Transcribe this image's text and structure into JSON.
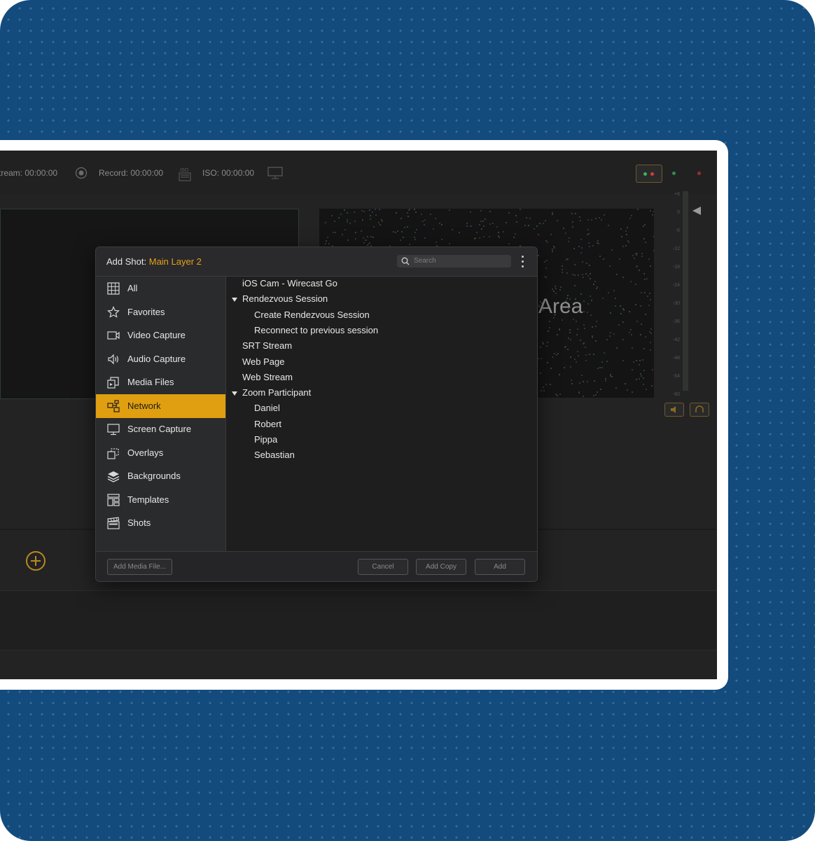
{
  "toolbar": {
    "stream_label": "tream: 00:00:00",
    "record_label": "Record: 00:00:00",
    "iso_label": "ISO: 00:00:00"
  },
  "preview": {
    "area_text": "Area"
  },
  "meter": {
    "labels": [
      "+6",
      "0",
      "-6",
      "-12",
      "-18",
      "-24",
      "-30",
      "-36",
      "-42",
      "-48",
      "-54",
      "-60"
    ]
  },
  "dialog": {
    "title_prefix": "Add Shot:",
    "layer_name": "Main Layer 2",
    "search_placeholder": "Search",
    "sidebar": [
      {
        "label": "All",
        "icon": "grid-icon"
      },
      {
        "label": "Favorites",
        "icon": "star-icon"
      },
      {
        "label": "Video Capture",
        "icon": "video-camera-icon"
      },
      {
        "label": "Audio Capture",
        "icon": "speaker-icon"
      },
      {
        "label": "Media Files",
        "icon": "media-files-icon"
      },
      {
        "label": "Network",
        "icon": "network-icon",
        "active": true
      },
      {
        "label": "Screen Capture",
        "icon": "monitor-icon"
      },
      {
        "label": "Overlays",
        "icon": "overlays-icon"
      },
      {
        "label": "Backgrounds",
        "icon": "layers-icon"
      },
      {
        "label": "Templates",
        "icon": "templates-icon"
      },
      {
        "label": "Shots",
        "icon": "clapperboard-icon"
      }
    ],
    "list": [
      {
        "label": "iOS Cam - Wirecast Go",
        "indent": 0
      },
      {
        "label": "Rendezvous Session",
        "indent": 0,
        "expanded": true
      },
      {
        "label": "Create Rendezvous Session",
        "indent": 1
      },
      {
        "label": "Reconnect to previous session",
        "indent": 1
      },
      {
        "label": "SRT Stream",
        "indent": 0
      },
      {
        "label": "Web Page",
        "indent": 0
      },
      {
        "label": "Web Stream",
        "indent": 0
      },
      {
        "label": "Zoom Participant",
        "indent": 0,
        "expanded": true
      },
      {
        "label": "Daniel",
        "indent": 1
      },
      {
        "label": "Robert",
        "indent": 1
      },
      {
        "label": "Pippa",
        "indent": 1
      },
      {
        "label": "Sebastian",
        "indent": 1
      }
    ],
    "footer": {
      "add_media_label": "Add Media File...",
      "cancel_label": "Cancel",
      "add_copy_label": "Add Copy",
      "add_label": "Add"
    }
  },
  "colors": {
    "accent": "#e09f10",
    "background": "#134b7d",
    "app": "#232324"
  }
}
